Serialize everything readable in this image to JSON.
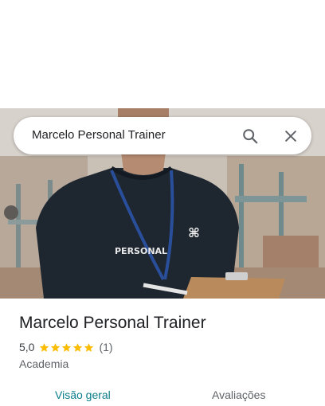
{
  "search": {
    "query": "Marcelo Personal Trainer"
  },
  "photo": {
    "shirt_print": "PERSONAL"
  },
  "place": {
    "name": "Marcelo Personal Trainer",
    "rating": "5,0",
    "stars": 5,
    "review_count": "(1)",
    "category": "Academia"
  },
  "tabs": [
    {
      "label": "Visão geral",
      "active": true
    },
    {
      "label": "Avaliações",
      "active": false
    }
  ],
  "colors": {
    "accent": "#0b7d8c",
    "star": "#fbbc04",
    "text_primary": "#202124",
    "text_secondary": "#5f6368"
  }
}
